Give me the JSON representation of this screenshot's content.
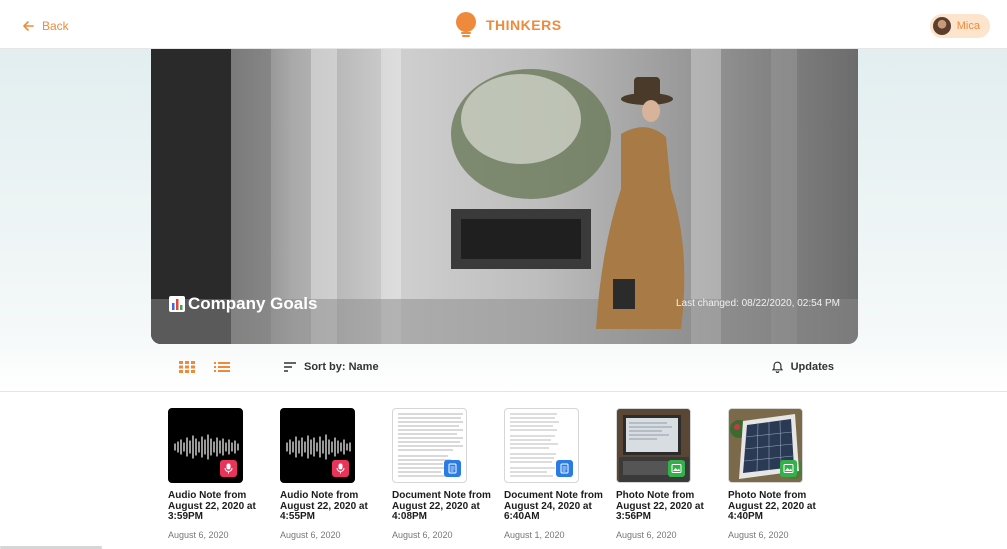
{
  "header": {
    "back_label": "Back",
    "logo_text": "THINKERS",
    "user_name": "Mica",
    "accent_color": "#ef8a3c"
  },
  "hero": {
    "title": "Company Goals",
    "title_icon": "bar-chart-icon",
    "last_changed": "Last changed: 08/22/2020, 02:54 PM"
  },
  "toolbar": {
    "grid_view_icon": "grid-view-icon",
    "list_view_icon": "list-view-icon",
    "sort_label": "Sort by: Name",
    "updates_label": "Updates"
  },
  "notes": [
    {
      "type": "audio",
      "title": "Audio Note from August 22, 2020 at 3:59PM",
      "date": "August 6, 2020",
      "badge_color": "#e8335a",
      "icon": "microphone-icon"
    },
    {
      "type": "audio",
      "title": "Audio Note from August 22, 2020 at 4:55PM",
      "date": "August 6, 2020",
      "badge_color": "#e8335a",
      "icon": "microphone-icon"
    },
    {
      "type": "document",
      "title": "Document Note from August 22, 2020 at 4:08PM",
      "date": "August 6, 2020",
      "badge_color": "#2b7be4",
      "icon": "document-scan-icon"
    },
    {
      "type": "document",
      "title": "Document Note from August 24, 2020 at 6:40AM",
      "date": "August 1, 2020",
      "badge_color": "#2b7be4",
      "icon": "document-scan-icon"
    },
    {
      "type": "photo",
      "title": "Photo Note from August 22, 2020 at 3:56PM",
      "date": "August 6, 2020",
      "badge_color": "#34b04a",
      "icon": "image-icon"
    },
    {
      "type": "photo",
      "title": "Photo Note from August 22, 2020 at 4:40PM",
      "date": "August 6, 2020",
      "badge_color": "#34b04a",
      "icon": "image-icon"
    }
  ]
}
